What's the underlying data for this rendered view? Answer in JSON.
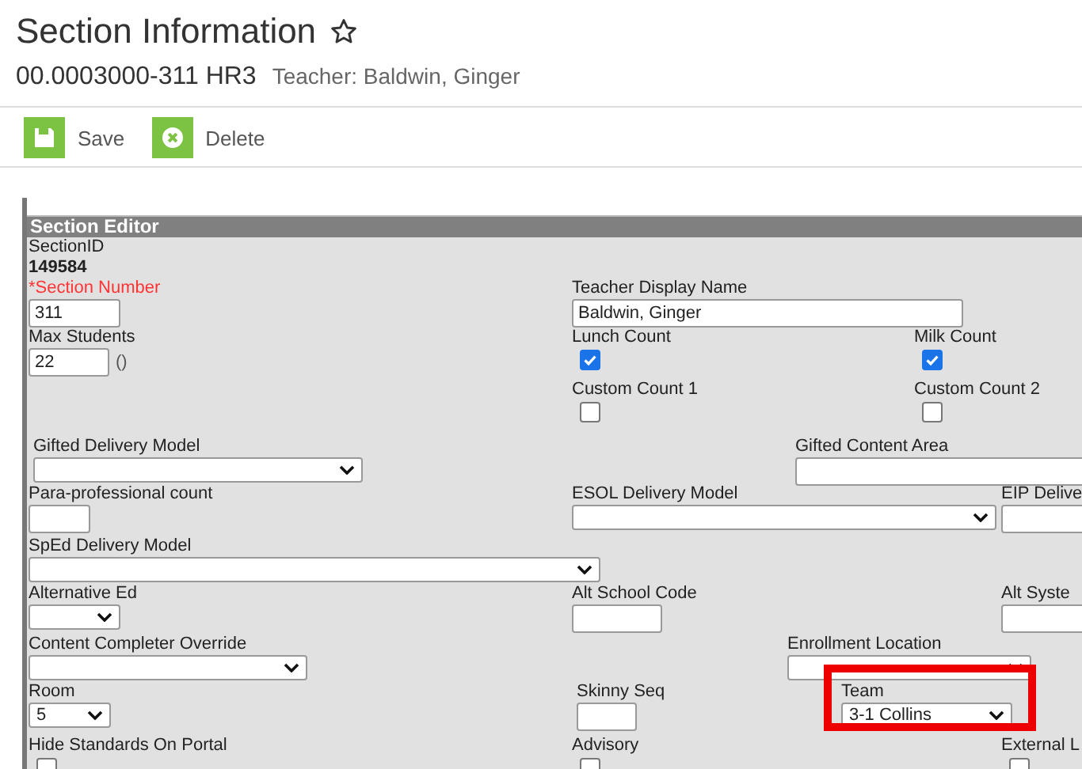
{
  "page": {
    "title": "Section Information",
    "code": "00.0003000-311 HR3",
    "teacher": "Teacher: Baldwin, Ginger"
  },
  "toolbar": [
    {
      "kind": "save",
      "label": "Save"
    },
    {
      "kind": "delete",
      "label": "Delete"
    }
  ],
  "editor": {
    "title": "Section Editor",
    "rows": [
      [
        [
          {
            "kind": "static",
            "label": "SectionID",
            "value": "149584"
          },
          {
            "kind": "text",
            "label": "*Section Number",
            "required": true,
            "value": "311"
          },
          {
            "kind": "text",
            "label": "Max Students",
            "value": "22",
            "suffix": "()"
          }
        ],
        [
          {
            "kind": "text",
            "label": "Teacher Display Name",
            "value": "Baldwin, Ginger"
          },
          {
            "kind": "checkbox",
            "label": "Lunch Count",
            "checked": true
          },
          {
            "kind": "checkbox",
            "label": "Custom Count 1",
            "checked": false
          }
        ],
        [
          {
            "kind": "checkbox",
            "label": "Milk Count",
            "checked": true
          },
          {
            "kind": "checkbox",
            "label": "Custom Count 2",
            "checked": false
          }
        ]
      ],
      [
        [
          {
            "kind": "select",
            "label": "Gifted Delivery Model"
          }
        ],
        [
          {
            "kind": "text",
            "label": "Gifted Content Area"
          }
        ]
      ],
      [
        [
          {
            "kind": "text",
            "label": "Para-professional count"
          }
        ],
        [
          {
            "kind": "select",
            "label": "ESOL Delivery Model"
          }
        ],
        [
          {
            "kind": "text",
            "label": "EIP Delive"
          }
        ]
      ],
      [
        [
          {
            "kind": "select",
            "label": "SpEd Delivery Model"
          }
        ]
      ],
      [
        [
          {
            "kind": "select",
            "label": "Alternative Ed"
          }
        ],
        [
          {
            "kind": "text",
            "label": "Alt School Code"
          }
        ],
        [
          {
            "kind": "text",
            "label": "Alt Syste"
          }
        ]
      ],
      [
        [
          {
            "kind": "select",
            "label": "Content Completer Override"
          }
        ],
        [
          {
            "kind": "select",
            "label": "Enrollment Location"
          }
        ]
      ],
      [
        [
          {
            "kind": "select",
            "label": "Room",
            "value": "5"
          }
        ],
        [
          {
            "kind": "text",
            "label": "Skinny Seq"
          }
        ],
        [
          {
            "kind": "select",
            "label": "Team",
            "value": "3-1 Collins",
            "highlighted": true
          }
        ]
      ],
      [
        [
          {
            "kind": "checkbox",
            "label": "Hide Standards On Portal",
            "checked": false
          }
        ],
        [
          {
            "kind": "checkbox",
            "label": "Advisory",
            "checked": false
          }
        ],
        [
          {
            "kind": "checkbox",
            "label": "External L",
            "checked": false
          }
        ]
      ]
    ]
  }
}
